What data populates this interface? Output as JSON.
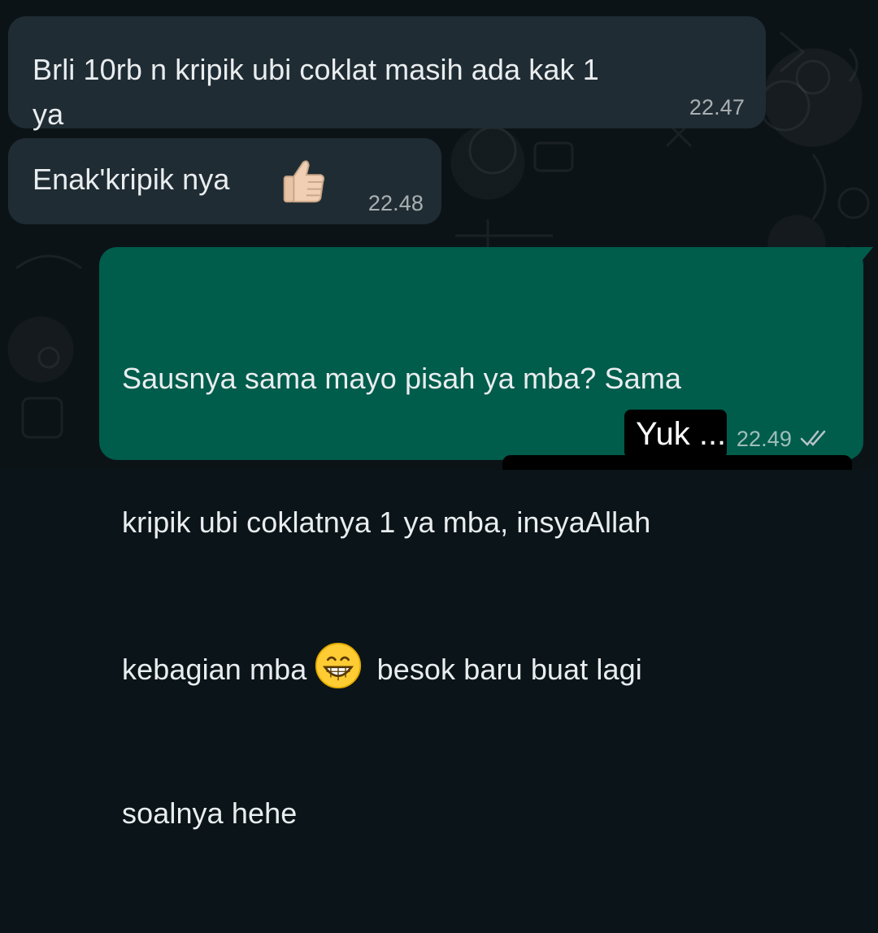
{
  "messages": [
    {
      "direction": "incoming",
      "lines": [
        "Brli 10rb n kripik ubi coklat masih ada kak 1",
        "ya"
      ],
      "time": "22.47"
    },
    {
      "direction": "incoming",
      "text": "Enak'kripik nya",
      "emoji": "thumbs-up",
      "time": "22.48"
    },
    {
      "direction": "outgoing",
      "line1": "Sausnya sama mayo pisah ya mba? Sama",
      "line2": "kripik ubi coklatnya 1 ya mba, insyaAllah",
      "line3_a": "kebagian mba",
      "line3_emoji": "grinning-face",
      "line3_b": "besok baru buat lagi",
      "line4": "soalnya hehe",
      "time": "22.49",
      "status": "read"
    }
  ],
  "overlay": {
    "sticker_text": "Yuk ..."
  },
  "colors": {
    "background": "#0c1317",
    "incoming_bubble": "#202c33",
    "outgoing_bubble": "#005c4b",
    "text": "#e9edef"
  }
}
